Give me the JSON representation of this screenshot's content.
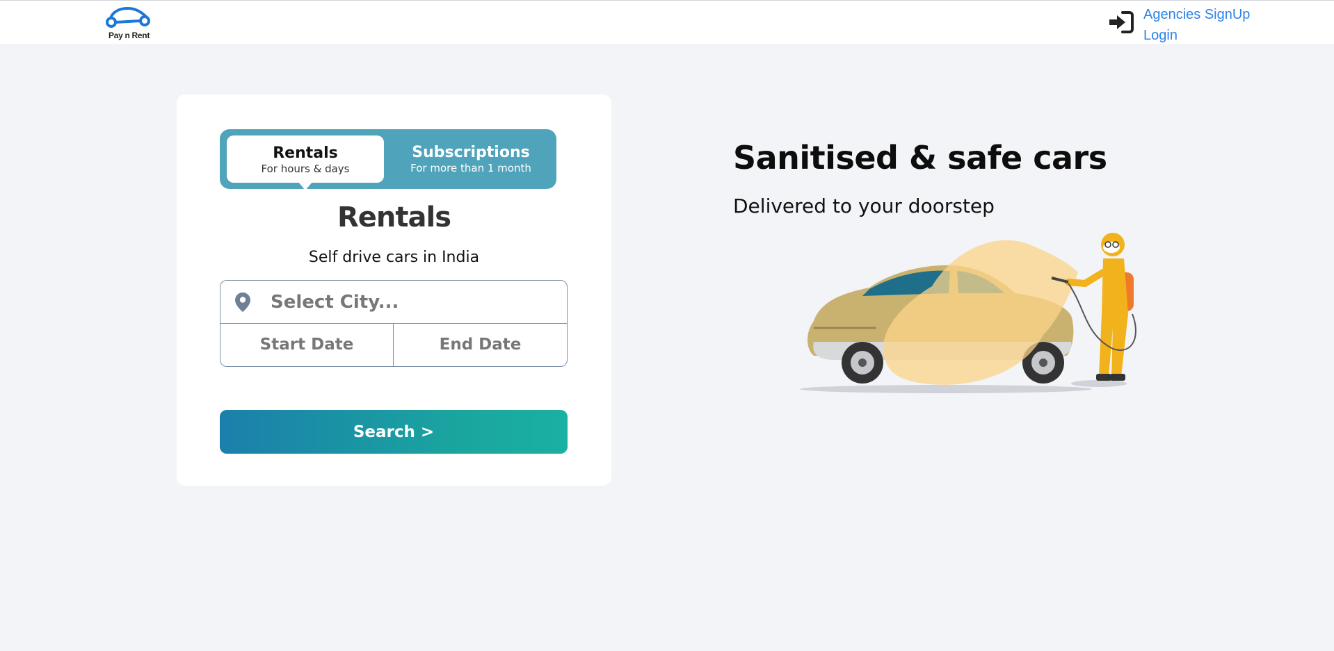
{
  "header": {
    "logo_text": "Pay n Rent",
    "links": [
      "Agencies SignUp",
      "Login"
    ]
  },
  "booking": {
    "tabs": [
      {
        "title": "Rentals",
        "subtitle": "For hours & days",
        "active": true
      },
      {
        "title": "Subscriptions",
        "subtitle": "For more than 1 month",
        "active": false
      }
    ],
    "brand": "Rentals",
    "tagline": "Self drive cars in India",
    "city_placeholder": "Select City...",
    "start_date": "Start Date",
    "end_date": "End Date",
    "search_label": "Search >"
  },
  "hero": {
    "headline": "Sanitised & safe cars",
    "subheadline": "Delivered to your doorstep"
  },
  "colors": {
    "accent": "#2c84e8",
    "tab_bg": "#4fa3ba",
    "button_start": "#1b7fab",
    "button_end": "#1ab0a3",
    "page_bg": "#f3f4f8"
  },
  "icons": [
    "logo-car-icon",
    "login-icon",
    "location-pin-icon"
  ]
}
